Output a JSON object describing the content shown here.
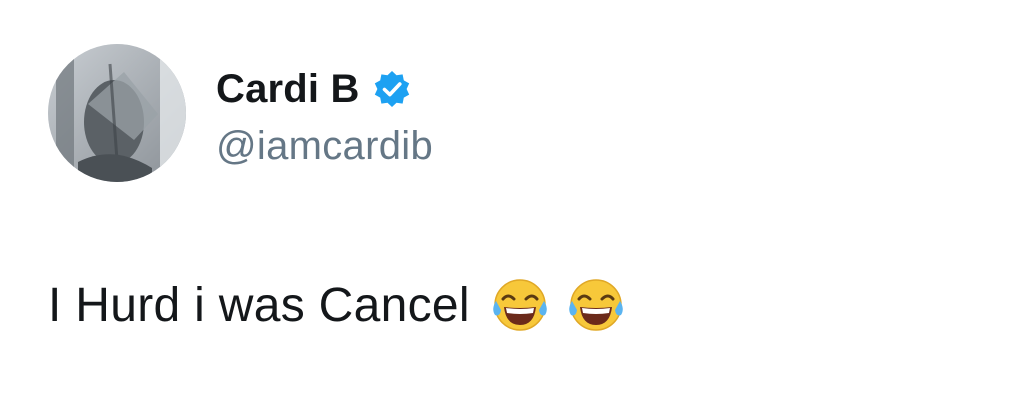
{
  "tweet": {
    "author": {
      "display_name": "Cardi B",
      "handle": "@iamcardib",
      "verified": true,
      "avatar_icon": "profile-photo"
    },
    "text": "I Hurd i was Cancel",
    "emojis": [
      "face-with-tears-of-joy-icon",
      "face-with-tears-of-joy-icon"
    ]
  },
  "colors": {
    "name": "#14171a",
    "handle": "#657786",
    "verified_badge": "#1da1f2",
    "background": "#ffffff"
  }
}
